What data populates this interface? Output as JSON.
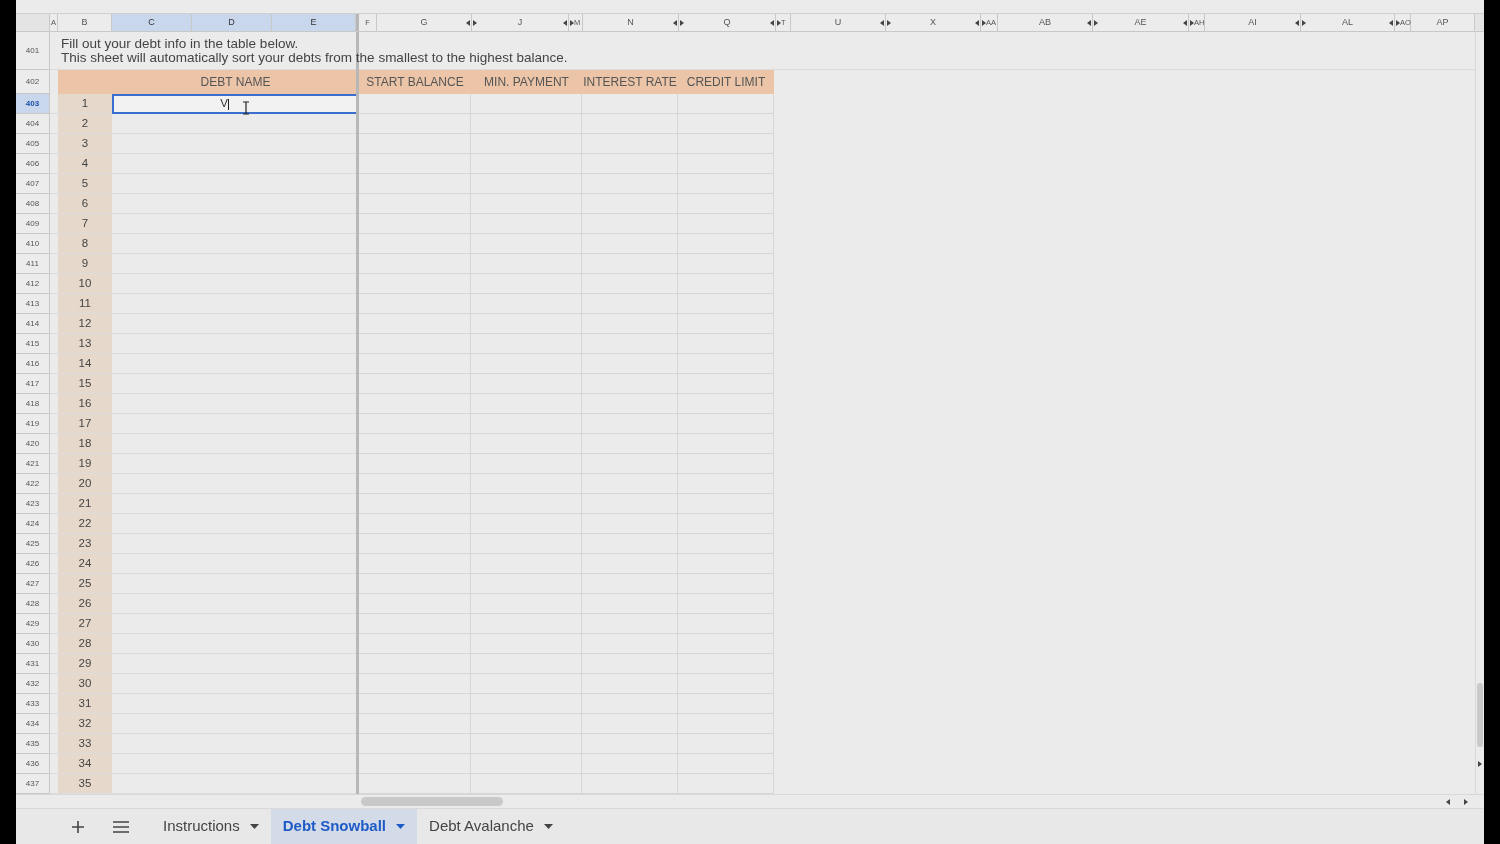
{
  "column_headers": [
    {
      "label": "A",
      "selected": false,
      "arrow_before": false,
      "arrow_after": false
    },
    {
      "label": "B",
      "selected": false,
      "arrow_before": false,
      "arrow_after": false
    },
    {
      "label": "C",
      "selected": true,
      "arrow_before": false,
      "arrow_after": false
    },
    {
      "label": "D",
      "selected": true,
      "arrow_before": false,
      "arrow_after": false
    },
    {
      "label": "E",
      "selected": true,
      "arrow_before": false,
      "arrow_after": false
    },
    {
      "label": "F",
      "selected": false,
      "arrow_before": false,
      "arrow_after": false
    },
    {
      "label": "G",
      "selected": false,
      "arrow_before": false,
      "arrow_after": true
    },
    {
      "label": "J",
      "selected": false,
      "arrow_before": true,
      "arrow_after": true
    },
    {
      "label": "M",
      "selected": false,
      "arrow_before": true,
      "arrow_after": false
    },
    {
      "label": "N",
      "selected": false,
      "arrow_before": false,
      "arrow_after": true
    },
    {
      "label": "Q",
      "selected": false,
      "arrow_before": true,
      "arrow_after": true
    },
    {
      "label": "T",
      "selected": false,
      "arrow_before": true,
      "arrow_after": false
    },
    {
      "label": "U",
      "selected": false,
      "arrow_before": false,
      "arrow_after": true
    },
    {
      "label": "X",
      "selected": false,
      "arrow_before": true,
      "arrow_after": true
    },
    {
      "label": "AA",
      "selected": false,
      "arrow_before": true,
      "arrow_after": false
    },
    {
      "label": "AB",
      "selected": false,
      "arrow_before": false,
      "arrow_after": true
    },
    {
      "label": "AE",
      "selected": false,
      "arrow_before": true,
      "arrow_after": true
    },
    {
      "label": "AH",
      "selected": false,
      "arrow_before": true,
      "arrow_after": false
    },
    {
      "label": "AI",
      "selected": false,
      "arrow_before": false,
      "arrow_after": true
    },
    {
      "label": "AL",
      "selected": false,
      "arrow_before": true,
      "arrow_after": true
    },
    {
      "label": "AO",
      "selected": false,
      "arrow_before": true,
      "arrow_after": false
    },
    {
      "label": "AP",
      "selected": false,
      "arrow_before": false,
      "arrow_after": false
    }
  ],
  "row_headers": [
    {
      "label": "401",
      "selected": false
    },
    {
      "label": "402",
      "selected": false
    },
    {
      "label": "403",
      "selected": true
    },
    {
      "label": "404",
      "selected": false
    },
    {
      "label": "405",
      "selected": false
    },
    {
      "label": "406",
      "selected": false
    },
    {
      "label": "407",
      "selected": false
    },
    {
      "label": "408",
      "selected": false
    },
    {
      "label": "409",
      "selected": false
    },
    {
      "label": "410",
      "selected": false
    },
    {
      "label": "411",
      "selected": false
    },
    {
      "label": "412",
      "selected": false
    },
    {
      "label": "413",
      "selected": false
    },
    {
      "label": "414",
      "selected": false
    },
    {
      "label": "415",
      "selected": false
    },
    {
      "label": "416",
      "selected": false
    },
    {
      "label": "417",
      "selected": false
    },
    {
      "label": "418",
      "selected": false
    },
    {
      "label": "419",
      "selected": false
    },
    {
      "label": "420",
      "selected": false
    },
    {
      "label": "421",
      "selected": false
    },
    {
      "label": "422",
      "selected": false
    },
    {
      "label": "423",
      "selected": false
    },
    {
      "label": "424",
      "selected": false
    },
    {
      "label": "425",
      "selected": false
    },
    {
      "label": "426",
      "selected": false
    },
    {
      "label": "427",
      "selected": false
    },
    {
      "label": "428",
      "selected": false
    },
    {
      "label": "429",
      "selected": false
    },
    {
      "label": "430",
      "selected": false
    },
    {
      "label": "431",
      "selected": false
    },
    {
      "label": "432",
      "selected": false
    },
    {
      "label": "433",
      "selected": false
    },
    {
      "label": "434",
      "selected": false
    },
    {
      "label": "435",
      "selected": false
    },
    {
      "label": "436",
      "selected": false
    },
    {
      "label": "437",
      "selected": false
    }
  ],
  "note_lines": [
    "Fill out your debt info in the table below.",
    "This sheet will automatically sort your debts from the smallest to the highest balance."
  ],
  "table": {
    "columns": [
      "DEBT NAME",
      "START BALANCE",
      "MIN. PAYMENT",
      "INTEREST RATE",
      "CREDIT LIMIT"
    ],
    "rows": [
      {
        "number": "1",
        "debt_name": "V",
        "active": true
      },
      {
        "number": "2",
        "active": false
      },
      {
        "number": "3",
        "active": false
      },
      {
        "number": "4",
        "active": false
      },
      {
        "number": "5",
        "active": false
      },
      {
        "number": "6",
        "active": false
      },
      {
        "number": "7",
        "active": false
      },
      {
        "number": "8",
        "active": false
      },
      {
        "number": "9",
        "active": false
      },
      {
        "number": "10",
        "active": false
      },
      {
        "number": "11",
        "active": false
      },
      {
        "number": "12",
        "active": false
      },
      {
        "number": "13",
        "active": false
      },
      {
        "number": "14",
        "active": false
      },
      {
        "number": "15",
        "active": false
      },
      {
        "number": "16",
        "active": false
      },
      {
        "number": "17",
        "active": false
      },
      {
        "number": "18",
        "active": false
      },
      {
        "number": "19",
        "active": false
      },
      {
        "number": "20",
        "active": false
      },
      {
        "number": "21",
        "active": false
      },
      {
        "number": "22",
        "active": false
      },
      {
        "number": "23",
        "active": false
      },
      {
        "number": "24",
        "active": false
      },
      {
        "number": "25",
        "active": false
      },
      {
        "number": "26",
        "active": false
      },
      {
        "number": "27",
        "active": false
      },
      {
        "number": "28",
        "active": false
      },
      {
        "number": "29",
        "active": false
      },
      {
        "number": "30",
        "active": false
      },
      {
        "number": "31",
        "active": false
      },
      {
        "number": "32",
        "active": false
      },
      {
        "number": "33",
        "active": false
      },
      {
        "number": "34",
        "active": false
      },
      {
        "number": "35",
        "active": false
      }
    ]
  },
  "sheet_tabs": [
    {
      "label": "Instructions",
      "selected": false
    },
    {
      "label": "Debt Snowball",
      "selected": true
    },
    {
      "label": "Debt Avalanche",
      "selected": false
    }
  ]
}
